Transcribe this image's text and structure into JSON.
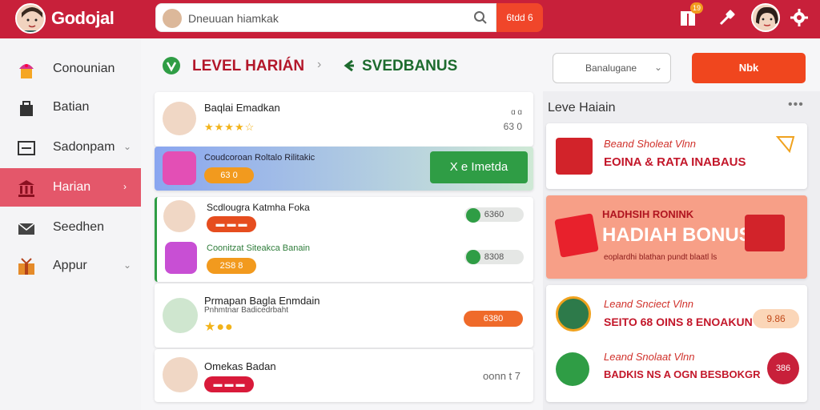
{
  "header": {
    "app_name": "Godojal",
    "search_placeholder": "Dneuuan hiamkak",
    "search_button": "6tdd 6",
    "notification_count": "19"
  },
  "sidebar": {
    "items": [
      {
        "label": "Conounian"
      },
      {
        "label": "Batian"
      },
      {
        "label": "Sadonpam"
      },
      {
        "label": "Harian"
      },
      {
        "label": "Seedhen"
      },
      {
        "label": "Appur"
      }
    ]
  },
  "main": {
    "tabs": [
      {
        "label": "LEVEL HARIÁN"
      },
      {
        "label": "SVEDBANUS"
      }
    ],
    "rows": [
      {
        "title": "Baqlai Emadkan",
        "meta_top": "ɑ ɑ",
        "meta": "63 0"
      },
      {
        "title": "Coudcoroan Roltalo Rilitakic",
        "badge": "63 0",
        "action": "X  e Imetda"
      },
      {
        "title": "Scdlougra Katmha Foka",
        "action": "6360"
      },
      {
        "title": "Coonitzat Siteakca Banain",
        "badge": "2S8 8",
        "action": "8308"
      },
      {
        "title": "Prmapan Bagla Enmdain",
        "subtitle": "Pnhmtnar Badicedrbaht",
        "action": "6380"
      },
      {
        "title": "Omekas Badan",
        "meta": "oonn t 7"
      }
    ]
  },
  "right": {
    "dropdown_value": "Banalugane",
    "cta_label": "Nbk",
    "section_title": "Leve Haiain",
    "promos": [
      {
        "line1": "Beand Sholeat Vlnn",
        "line2": "EOINA & RATA INABAUS"
      },
      {
        "line1": "HADHSIH RONINK",
        "line2": "HADIAH BONUS",
        "line3": "eoplardhi blathan pundt blaatl ls"
      },
      {
        "line1": "Leand Snciect Vlnn",
        "line2": "SEITO 68 OINS 8 ENOAKUN",
        "badge": "9.86"
      },
      {
        "line1": "Leand Snolaat Vlnn",
        "line2": "BADKIS NS A OGN BESBOKGR",
        "badge": "386"
      }
    ]
  },
  "colors": {
    "header": "#c8203a",
    "accent": "#f0461e",
    "active_nav": "#e4576a",
    "green": "#2f9d45",
    "tab_green": "#1d6b2e"
  },
  "icons": [
    "search-icon",
    "notification-icon",
    "tools-icon",
    "gear-icon",
    "cupcake-icon",
    "briefcase-icon",
    "menu-icon",
    "bank-icon",
    "mail-icon",
    "gift-icon"
  ]
}
